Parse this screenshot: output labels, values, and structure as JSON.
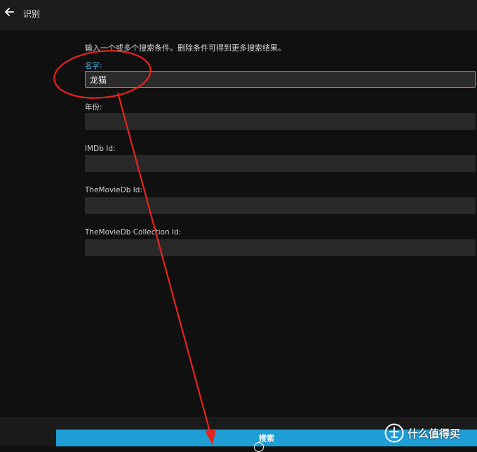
{
  "header": {
    "title": "识别",
    "back_icon": "arrow-left-icon"
  },
  "form": {
    "instructions": "输入一个或多个搜索条件。删除条件可得到更多搜索结果。",
    "fields": [
      {
        "label": "名字:",
        "value": "龙猫",
        "focused": true
      },
      {
        "label": "年份:",
        "value": ""
      },
      {
        "label": "IMDb Id:",
        "value": ""
      },
      {
        "label": "TheMovieDb Id:",
        "value": ""
      },
      {
        "label": "TheMovieDb Collection Id:",
        "value": ""
      }
    ]
  },
  "footer": {
    "search_label": "搜索"
  },
  "watermark": {
    "text": "什么值得买",
    "icon": "smzdm-logo-icon"
  },
  "colors": {
    "accent": "#1f9ed6",
    "focus_label": "#52b6e6",
    "annotation": "#e8231f"
  }
}
